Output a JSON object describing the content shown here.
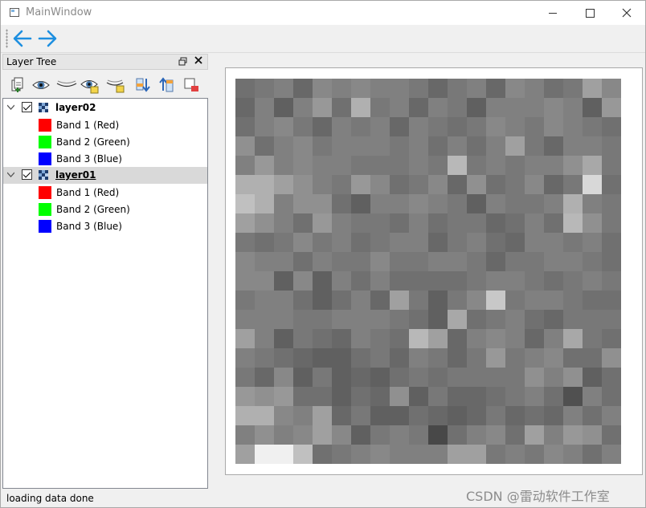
{
  "window": {
    "title": "MainWindow",
    "controls": [
      "minimize",
      "maximize",
      "close"
    ]
  },
  "toolbar": {
    "items": [
      {
        "name": "back",
        "icon": "arrow-left-icon",
        "color": "#1e8fe0"
      },
      {
        "name": "forward",
        "icon": "arrow-right-icon",
        "color": "#1e8fe0"
      }
    ]
  },
  "layer_panel": {
    "title": "Layer Tree",
    "tools": [
      {
        "icon": "add-layer-icon"
      },
      {
        "icon": "show-all-icon"
      },
      {
        "icon": "hide-all-icon"
      },
      {
        "icon": "show-selected-icon"
      },
      {
        "icon": "hide-selected-icon"
      },
      {
        "icon": "move-down-icon"
      },
      {
        "icon": "move-up-icon"
      },
      {
        "icon": "remove-layer-icon"
      }
    ],
    "layers": [
      {
        "name": "layer02",
        "checked": true,
        "selected": false,
        "bands": [
          {
            "label": "Band 1 (Red)",
            "color": "#ff0000"
          },
          {
            "label": "Band 2 (Green)",
            "color": "#00ff00"
          },
          {
            "label": "Band 3 (Blue)",
            "color": "#0000ff"
          }
        ]
      },
      {
        "name": "layer01",
        "checked": true,
        "selected": true,
        "bands": [
          {
            "label": "Band 1 (Red)",
            "color": "#ff0000"
          },
          {
            "label": "Band 2 (Green)",
            "color": "#00ff00"
          },
          {
            "label": "Band 3 (Blue)",
            "color": "#0000ff"
          }
        ]
      }
    ]
  },
  "map_canvas": {
    "raster_grid_size": 20,
    "gray_levels": [
      112,
      120,
      128,
      104,
      136,
      128,
      136,
      128,
      128,
      120,
      104,
      120,
      128,
      104,
      136,
      128,
      112,
      120,
      160,
      136,
      104,
      128,
      96,
      128,
      152,
      112,
      176,
      120,
      128,
      104,
      128,
      120,
      96,
      128,
      128,
      128,
      136,
      128,
      96,
      152,
      112,
      128,
      136,
      120,
      104,
      128,
      120,
      128,
      104,
      128,
      120,
      112,
      120,
      136,
      128,
      120,
      136,
      128,
      120,
      112,
      144,
      112,
      128,
      136,
      120,
      128,
      128,
      128,
      120,
      128,
      112,
      128,
      112,
      128,
      160,
      120,
      104,
      128,
      128,
      120,
      128,
      152,
      128,
      136,
      128,
      128,
      120,
      120,
      120,
      128,
      120,
      184,
      120,
      128,
      120,
      128,
      128,
      144,
      168,
      120,
      176,
      176,
      160,
      144,
      128,
      120,
      152,
      136,
      112,
      120,
      136,
      104,
      144,
      112,
      120,
      136,
      104,
      120,
      216,
      112,
      192,
      176,
      128,
      144,
      144,
      112,
      96,
      128,
      128,
      136,
      128,
      120,
      96,
      128,
      120,
      120,
      128,
      176,
      128,
      120,
      160,
      144,
      128,
      112,
      152,
      128,
      120,
      120,
      112,
      128,
      112,
      120,
      120,
      104,
      112,
      128,
      112,
      184,
      144,
      120,
      120,
      112,
      120,
      136,
      120,
      128,
      112,
      120,
      128,
      128,
      104,
      120,
      128,
      112,
      104,
      128,
      128,
      120,
      128,
      112,
      136,
      128,
      128,
      112,
      128,
      120,
      120,
      136,
      120,
      120,
      128,
      128,
      120,
      104,
      120,
      120,
      128,
      128,
      120,
      112,
      136,
      136,
      96,
      136,
      96,
      128,
      112,
      128,
      112,
      112,
      112,
      112,
      120,
      128,
      128,
      120,
      112,
      120,
      128,
      120,
      120,
      128,
      128,
      112,
      96,
      112,
      128,
      104,
      160,
      120,
      96,
      120,
      136,
      200,
      120,
      128,
      128,
      120,
      112,
      112,
      128,
      128,
      128,
      120,
      120,
      128,
      128,
      128,
      120,
      112,
      96,
      168,
      112,
      120,
      128,
      112,
      104,
      120,
      120,
      120,
      160,
      128,
      96,
      120,
      112,
      104,
      128,
      120,
      112,
      184,
      160,
      104,
      128,
      136,
      128,
      104,
      128,
      168,
      120,
      112,
      128,
      120,
      112,
      104,
      96,
      96,
      112,
      120,
      104,
      128,
      120,
      104,
      120,
      152,
      120,
      128,
      136,
      112,
      112,
      144,
      120,
      104,
      136,
      96,
      120,
      96,
      104,
      96,
      112,
      120,
      112,
      120,
      120,
      120,
      120,
      144,
      128,
      144,
      96,
      112,
      152,
      144,
      152,
      112,
      112,
      96,
      112,
      104,
      144,
      96,
      120,
      104,
      104,
      112,
      120,
      128,
      112,
      80,
      128,
      112,
      176,
      176,
      136,
      128,
      160,
      104,
      120,
      96,
      96,
      112,
      104,
      96,
      104,
      120,
      104,
      112,
      104,
      128,
      112,
      128,
      128,
      144,
      128,
      136,
      160,
      136,
      96,
      120,
      128,
      120,
      72,
      112,
      128,
      136,
      112,
      160,
      128,
      152,
      144,
      112,
      160,
      240,
      240,
      192,
      112,
      120,
      128,
      136,
      128,
      128,
      128,
      160,
      160,
      120,
      128,
      120,
      136,
      128,
      112,
      128
    ]
  },
  "status_bar": {
    "message": "loading data done"
  },
  "watermark": {
    "text": "CSDN @雷动软件工作室"
  }
}
